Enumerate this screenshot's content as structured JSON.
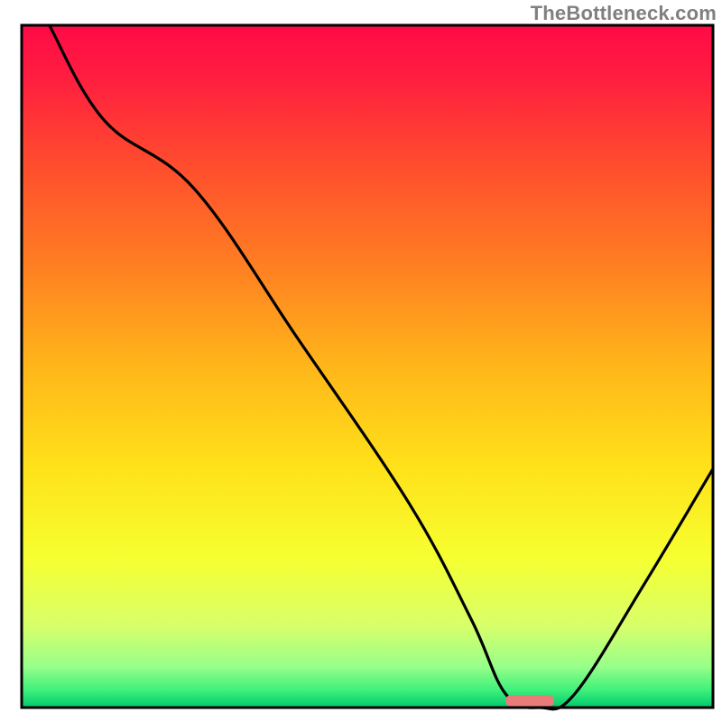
{
  "watermark": "TheBottleneck.com",
  "colors": {
    "curve_stroke": "#000000",
    "marker_fill": "#e97b7b",
    "frame_stroke": "#000000",
    "gradient_stops": [
      {
        "offset": 0.0,
        "color": "#ff0a47"
      },
      {
        "offset": 0.08,
        "color": "#ff1f3f"
      },
      {
        "offset": 0.2,
        "color": "#ff4b2e"
      },
      {
        "offset": 0.35,
        "color": "#ff7e22"
      },
      {
        "offset": 0.5,
        "color": "#ffb61a"
      },
      {
        "offset": 0.65,
        "color": "#ffe21a"
      },
      {
        "offset": 0.78,
        "color": "#f6ff30"
      },
      {
        "offset": 0.88,
        "color": "#d8ff6a"
      },
      {
        "offset": 0.94,
        "color": "#98ff8a"
      },
      {
        "offset": 0.975,
        "color": "#3cf07a"
      },
      {
        "offset": 1.0,
        "color": "#00c86e"
      }
    ]
  },
  "chart_data": {
    "type": "line",
    "title": "",
    "xlabel": "",
    "ylabel": "",
    "xlim": [
      0,
      100
    ],
    "ylim": [
      0,
      100
    ],
    "x": [
      4,
      12,
      25,
      40,
      56,
      65,
      70,
      75,
      80,
      90,
      100
    ],
    "values": [
      100,
      86,
      76,
      54,
      30,
      13,
      2,
      0,
      2,
      18,
      35
    ],
    "marker": {
      "x_start": 70,
      "x_end": 77,
      "y": 0
    },
    "notes": "x is relative horizontal position (percent of plot width left→right); values are relative height (percent of plot height, 0 at bottom green band, 100 at top). Axes are unlabeled in source image — numeric scale is estimated from pixel position only. Marker is the short pink segment resting on the x-axis near the curve minimum."
  }
}
